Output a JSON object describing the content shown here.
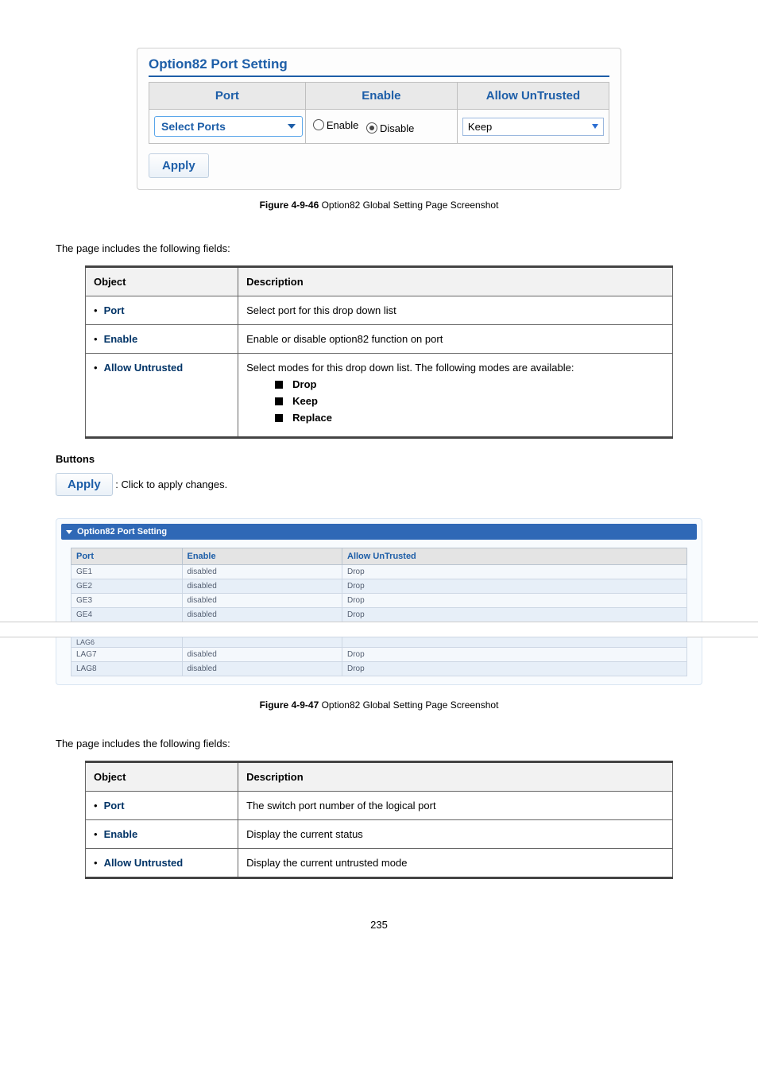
{
  "panel1": {
    "title": "Option82 Port Setting",
    "headers": {
      "port": "Port",
      "enable": "Enable",
      "allow": "Allow UnTrusted"
    },
    "select_ports_label": "Select Ports",
    "radio_enable": "Enable",
    "radio_disable": "Disable",
    "radio_selected": "disable",
    "allow_selected": "Keep",
    "apply_label": "Apply"
  },
  "caption1": {
    "prefix": "Figure 4-9-46",
    "text": " Option82 Global Setting Page Screenshot"
  },
  "intro1": "The page includes the following fields:",
  "docTable1": {
    "head_object": "Object",
    "head_desc": "Description",
    "rows": [
      {
        "object": "Port",
        "desc": "Select port for this drop down list"
      },
      {
        "object": "Enable",
        "desc": "Enable or disable option82 function on port"
      },
      {
        "object": "Allow Untrusted",
        "desc_intro": "Select modes for this drop down list. The following modes are available:",
        "modes": [
          "Drop",
          "Keep",
          "Replace"
        ]
      }
    ]
  },
  "buttons_heading": "Buttons",
  "apply_btn_label": "Apply",
  "apply_btn_desc": ": Click to apply changes.",
  "panel2": {
    "accordion_title": "Option82 Port Setting",
    "headers": {
      "port": "Port",
      "enable": "Enable",
      "allow": "Allow UnTrusted"
    },
    "rows_top": [
      {
        "port": "GE1",
        "enable": "disabled",
        "allow": "Drop"
      },
      {
        "port": "GE2",
        "enable": "disabled",
        "allow": "Drop"
      },
      {
        "port": "GE3",
        "enable": "disabled",
        "allow": "Drop"
      },
      {
        "port": "GE4",
        "enable": "disabled",
        "allow": "Drop"
      }
    ],
    "rows_bottom": [
      {
        "port": "LAG6",
        "enable": "",
        "allow": ""
      },
      {
        "port": "LAG7",
        "enable": "disabled",
        "allow": "Drop"
      },
      {
        "port": "LAG8",
        "enable": "disabled",
        "allow": "Drop"
      }
    ]
  },
  "caption2": {
    "prefix": "Figure 4-9-47",
    "text": " Option82 Global Setting Page Screenshot"
  },
  "intro2": "The page includes the following fields:",
  "docTable2": {
    "head_object": "Object",
    "head_desc": "Description",
    "rows": [
      {
        "object": "Port",
        "desc": "The switch port number of the logical port"
      },
      {
        "object": "Enable",
        "desc": "Display the current status"
      },
      {
        "object": "Allow Untrusted",
        "desc": "Display the current untrusted mode"
      }
    ]
  },
  "page_number": "235"
}
